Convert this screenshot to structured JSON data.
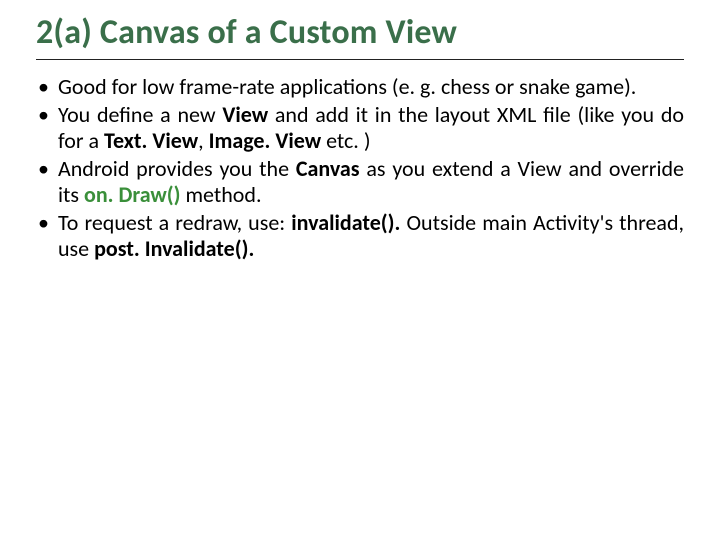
{
  "title": "2(a) Canvas of a Custom View",
  "bullets": {
    "b1": {
      "t1": "Good for low frame-rate applications (e. g. chess or snake game)."
    },
    "b2": {
      "t1": "You define a new ",
      "view": "View",
      "t2": " and add it in the layout XML file (like you do for a ",
      "tv": "Text. View",
      "t3": ", ",
      "iv": "Image. View",
      "t4": " etc. )"
    },
    "b3": {
      "t1": "Android provides you the ",
      "canvas": "Canvas",
      "t2": " as you extend a View and override its ",
      "ondraw": "on. Draw()",
      "t3": " method."
    },
    "b4": {
      "t1": "To request a redraw, use: ",
      "inv": "invalidate().",
      "t2": " Outside main Activity's thread, use ",
      "pinv": "post. Invalidate().",
      "t3": ""
    }
  }
}
